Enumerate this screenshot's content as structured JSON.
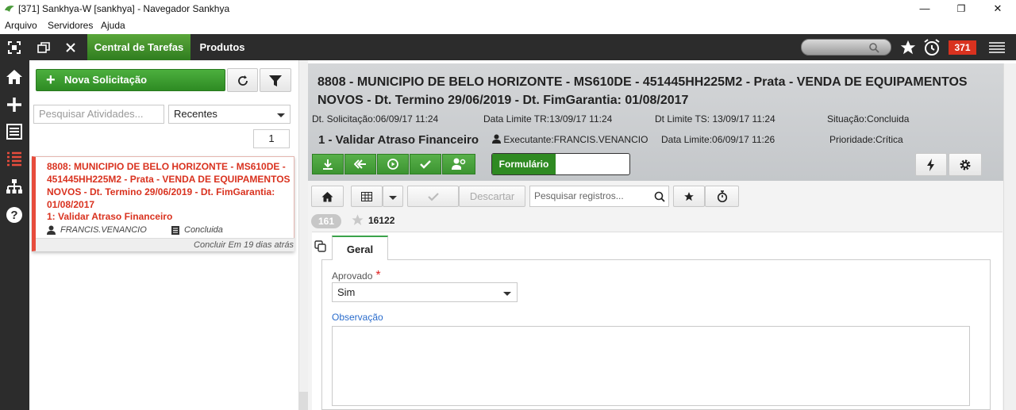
{
  "window": {
    "title": "[371] Sankhya-W [sankhya] - Navegador Sankhya",
    "minimize": "—",
    "maximize": "❐",
    "close": "✕"
  },
  "menu": [
    "Arquivo",
    "Servidores",
    "Ajuda"
  ],
  "toolbar": {
    "tabs": [
      "Central de Tarefas",
      "Produtos"
    ],
    "notification_count": "371",
    "accent_color": "#2f8a22",
    "badge_color": "#d9321f"
  },
  "sidebar": {
    "icons": [
      "home-icon",
      "add-icon",
      "list-icon",
      "tasks-icon",
      "org-chart-icon",
      "help-icon"
    ]
  },
  "left": {
    "new_button": "Nova Solicitação",
    "search_placeholder": "Pesquisar Atividades...",
    "filter_value": "Recentes",
    "page": "1",
    "task": {
      "title": "8808: MUNICIPIO DE BELO HORIZONTE - MS610DE - 451445HH225M2 - Prata - VENDA DE EQUIPAMENTOS NOVOS - Dt. Termino 29/06/2019 - Dt. FimGarantia: 01/08/2017",
      "step": "1: Validar Atraso Financeiro",
      "executor": "FRANCIS.VENANCIO",
      "status": "Concluida",
      "footer": "Concluir Em 19 dias atrás"
    }
  },
  "header": {
    "title": "8808 - MUNICIPIO DE BELO HORIZONTE - MS610DE - 451445HH225M2 - Prata - VENDA DE EQUIPAMENTOS NOVOS - Dt. Termino 29/06/2019 - Dt. FimGarantia: 01/08/2017",
    "dt_solicitacao_label": "Dt. Solicitação:",
    "dt_solicitacao": "06/09/17 11:24",
    "data_limite_tr_label": "Data Limite TR:",
    "data_limite_tr": "13/09/17 11:24",
    "dt_limite_ts_label": "Dt Limite TS:",
    "dt_limite_ts": "13/09/17 11:24",
    "situacao_label": "Situação:",
    "situacao": "Concluida",
    "etapa": "1 - Validar Atraso Financeiro",
    "executante_label": "Executante:",
    "executante": "FRANCIS.VENANCIO",
    "data_limite_label": "Data Limite:",
    "data_limite": "06/09/17 11:26",
    "prioridade_label": "Prioridade:",
    "prioridade": "Crítica",
    "formulario": "Formulário"
  },
  "records": {
    "descartar": "Descartar",
    "search_placeholder": "Pesquisar registros...",
    "count": "161",
    "record_id": "16122"
  },
  "form": {
    "tab": "Geral",
    "aprovado_label": "Aprovado",
    "required_mark": "*",
    "aprovado_value": "Sim",
    "observacao_label": "Observação"
  }
}
